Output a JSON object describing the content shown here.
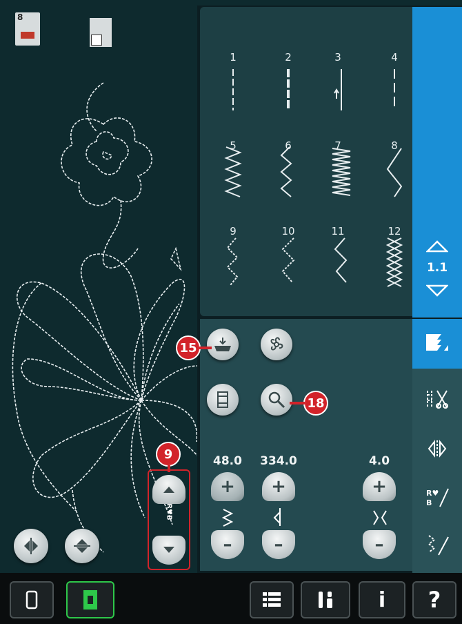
{
  "embroidery": {
    "hoop_icon_label": "8"
  },
  "stitches": [
    {
      "num": "1"
    },
    {
      "num": "2"
    },
    {
      "num": "3"
    },
    {
      "num": "4"
    },
    {
      "num": "5"
    },
    {
      "num": "6"
    },
    {
      "num": "7"
    },
    {
      "num": "8"
    },
    {
      "num": "9"
    },
    {
      "num": "10"
    },
    {
      "num": "11"
    },
    {
      "num": "12"
    }
  ],
  "pager": {
    "label": "1.1"
  },
  "settings": {
    "width_value": "48.0",
    "length_value": "334.0",
    "density_value": "4.0",
    "plus": "+",
    "minus": "–",
    "mirror_label": "R♥B"
  },
  "callouts": {
    "c15": "15",
    "c18": "18",
    "c9": "9"
  },
  "bottom": {
    "info": "i",
    "help": "?"
  },
  "colors": {
    "accent_blue": "#1a8fd6",
    "callout_red": "#d2232a",
    "active_green": "#2ec84a"
  }
}
